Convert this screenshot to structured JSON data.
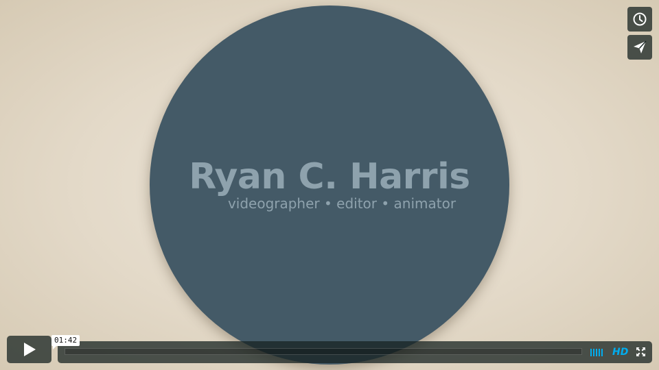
{
  "video": {
    "title_card": {
      "name": "Ryan C. Harris",
      "tagline": "videographer • editor • animator"
    }
  },
  "side_controls": {
    "watch_later_icon": "clock-icon",
    "share_icon": "paper-plane-icon"
  },
  "player": {
    "play_icon": "play-icon",
    "time_tooltip": "01:42",
    "volume_icon": "volume-bars-icon",
    "hd_label": "HD",
    "fullscreen_icon": "fullscreen-icon"
  },
  "colors": {
    "accent": "#00adef",
    "circle": "#445a67",
    "background": "#e3d9c8",
    "controls_bg": "#172322"
  }
}
